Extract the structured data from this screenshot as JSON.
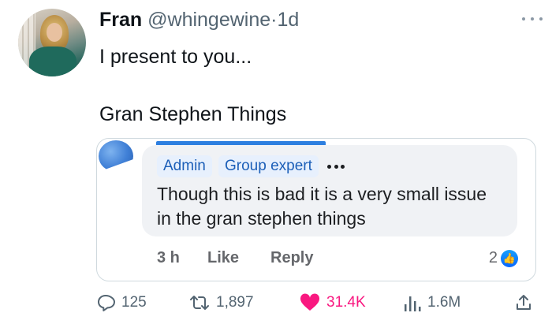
{
  "tweet": {
    "display_name": "Fran",
    "handle": "@whingewine",
    "separator": "·",
    "time": "1d",
    "line1": "I present to you...",
    "line2": "Gran Stephen Things"
  },
  "embedded_comment": {
    "badges": [
      "Admin",
      "Group expert"
    ],
    "text": "Though this is bad it is a very small issue in the gran stephen things",
    "time_ago": "3 h",
    "like_label": "Like",
    "reply_label": "Reply",
    "reaction_count": "2",
    "reaction_icon": "thumbs-up-icon"
  },
  "stats": {
    "replies": "125",
    "reposts": "1,897",
    "likes": "31.4K",
    "views": "1.6M"
  },
  "colors": {
    "text": "#0f1419",
    "muted": "#536471",
    "like_pink": "#f91880",
    "fb_blue": "#1c5fb8"
  }
}
